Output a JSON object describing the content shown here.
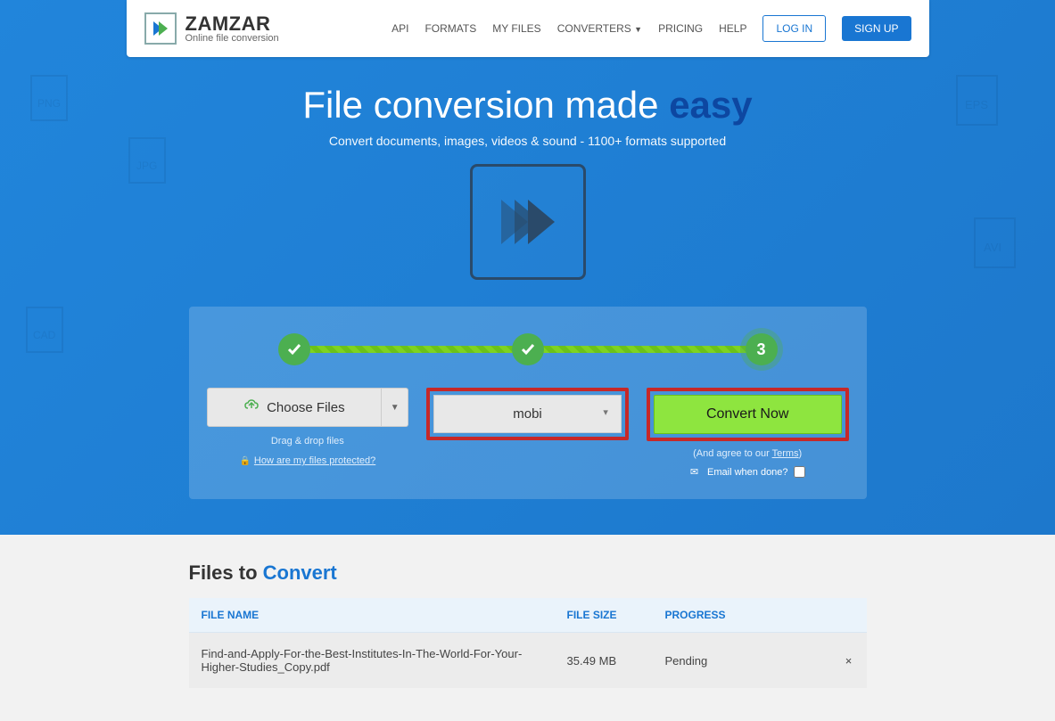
{
  "nav": {
    "brand_name": "ZAMZAR",
    "brand_tag": "Online file conversion",
    "links": [
      "API",
      "FORMATS",
      "MY FILES",
      "CONVERTERS",
      "PRICING",
      "HELP"
    ],
    "login": "LOG IN",
    "signup": "SIGN UP"
  },
  "headline": {
    "title_pre": "File conversion made ",
    "title_em": "easy",
    "subtitle": "Convert documents, images, videos & sound - 1100+ formats supported"
  },
  "steps": {
    "current": "3"
  },
  "choose": {
    "label": "Choose Files",
    "hint_drag": "Drag & drop files",
    "hint_protect": "How are my files protected?"
  },
  "format": {
    "selected": "mobi"
  },
  "convert": {
    "label": "Convert Now",
    "agree_pre": "(And agree to our ",
    "agree_link": "Terms",
    "agree_post": ")",
    "email_label": "Email when done?"
  },
  "files": {
    "title_pre": "Files to ",
    "title_accent": "Convert",
    "headers": {
      "name": "FILE NAME",
      "size": "FILE SIZE",
      "progress": "PROGRESS"
    },
    "rows": [
      {
        "name": "Find-and-Apply-For-the-Best-Institutes-In-The-World-For-Your-Higher-Studies_Copy.pdf",
        "size": "35.49 MB",
        "progress": "Pending"
      }
    ]
  }
}
